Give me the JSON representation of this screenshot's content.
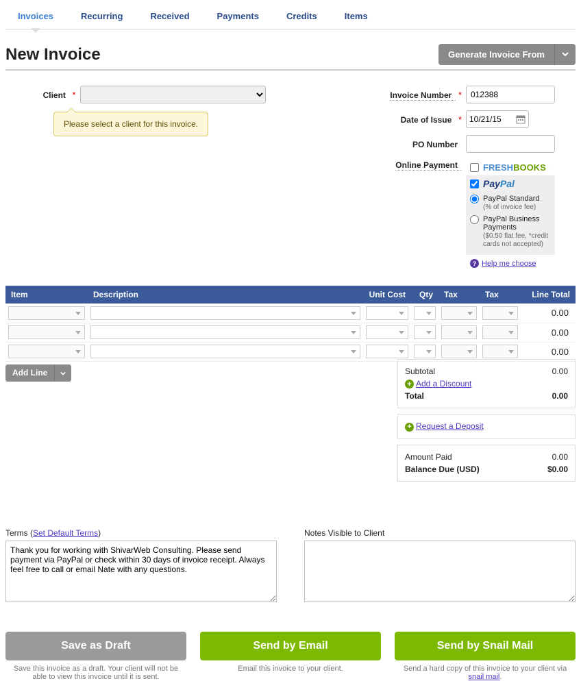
{
  "tabs": [
    "Invoices",
    "Recurring",
    "Received",
    "Payments",
    "Credits",
    "Items"
  ],
  "active_tab": 0,
  "page_title": "New Invoice",
  "generate_button": "Generate Invoice From",
  "form": {
    "client_label": "Client",
    "tooltip": "Please select a client for this invoice.",
    "invoice_number_label": "Invoice Number",
    "invoice_number": "012388",
    "date_label": "Date of Issue",
    "date": "10/21/15",
    "po_label": "PO Number",
    "po_value": "",
    "online_payment_label": "Online Payment"
  },
  "payment": {
    "freshbooks_checked": false,
    "paypal_checked": true,
    "paypal_standard": {
      "label": "PayPal Standard",
      "sub": "(% of invoice fee)",
      "selected": true
    },
    "paypal_business": {
      "label": "PayPal Business Payments",
      "sub": "($0.50 flat fee, *credit cards not accepted)",
      "selected": false
    },
    "help_link": "Help me choose"
  },
  "table": {
    "headers": {
      "item": "Item",
      "description": "Description",
      "unit_cost": "Unit Cost",
      "qty": "Qty",
      "tax1": "Tax",
      "tax2": "Tax",
      "line_total": "Line Total"
    },
    "rows": [
      {
        "total": "0.00"
      },
      {
        "total": "0.00"
      },
      {
        "total": "0.00"
      }
    ]
  },
  "add_line_label": "Add Line",
  "totals": {
    "subtotal_label": "Subtotal",
    "subtotal": "0.00",
    "add_discount": "Add a Discount",
    "total_label": "Total",
    "total": "0.00",
    "request_deposit": "Request a Deposit",
    "amount_paid_label": "Amount Paid",
    "amount_paid": "0.00",
    "balance_label": "Balance Due (USD)",
    "balance": "$0.00"
  },
  "terms": {
    "label_prefix": "Terms (",
    "set_default_link": "Set Default Terms",
    "label_suffix": ")",
    "value": "Thank you for working with ShivarWeb Consulting. Please send payment via PayPal or check within 30 days of invoice receipt. Always feel free to call or email Nate with any questions."
  },
  "notes": {
    "label": "Notes Visible to Client",
    "value": ""
  },
  "actions": {
    "draft": {
      "label": "Save as Draft",
      "desc": "Save this invoice as a draft. Your client will not be able to view this invoice until it is sent."
    },
    "email": {
      "label": "Send by Email",
      "desc": "Email this invoice to your client."
    },
    "snail": {
      "label": "Send by Snail Mail",
      "desc_prefix": "Send a hard copy of this invoice to your client via ",
      "desc_link": "snail mail",
      "desc_suffix": "."
    }
  }
}
